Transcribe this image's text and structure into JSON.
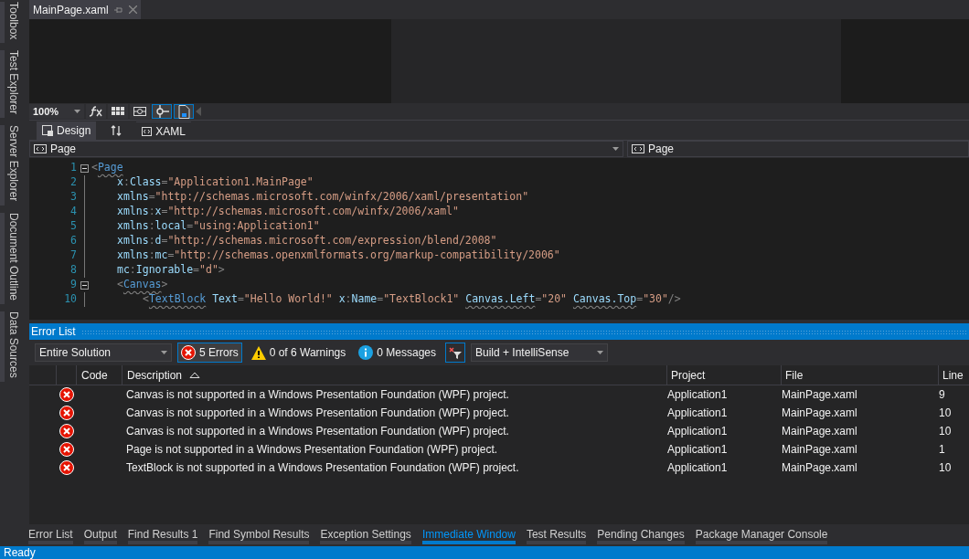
{
  "side_tabs": [
    "Toolbox",
    "Test Explorer",
    "Server Explorer",
    "Document Outline",
    "Data Sources"
  ],
  "document_tab": {
    "title": "MainPage.xaml"
  },
  "designer_toolbar": {
    "zoom": "100%",
    "buttons": [
      {
        "kind": "fx",
        "on": false
      },
      {
        "kind": "grid",
        "on": false
      },
      {
        "kind": "snap-grid",
        "on": false
      },
      {
        "kind": "snap-lines",
        "on": true
      },
      {
        "kind": "project-code",
        "on": true
      }
    ]
  },
  "view_tabs": [
    {
      "label": "Design",
      "kind": "design",
      "selected": true
    },
    {
      "label": "XAML",
      "kind": "xaml",
      "selected": false
    }
  ],
  "nav_bar": {
    "left": "Page",
    "right": "Page"
  },
  "code_lines": [
    {
      "number": "1",
      "fold": true,
      "tokens": [
        {
          "kind": "punct",
          "text": "<"
        },
        {
          "kind": "tag",
          "text": "Page",
          "squiggle": true
        }
      ]
    },
    {
      "number": "2",
      "fold": false,
      "tokens": [
        {
          "kind": "attr",
          "text": "x"
        },
        {
          "kind": "punct",
          "text": ":"
        },
        {
          "kind": "attr",
          "text": "Class"
        },
        {
          "kind": "punct",
          "text": "="
        },
        {
          "kind": "value",
          "text": "\"Application1.MainPage\""
        }
      ]
    },
    {
      "number": "3",
      "fold": false,
      "tokens": [
        {
          "kind": "attr",
          "text": "xmlns"
        },
        {
          "kind": "punct",
          "text": "="
        },
        {
          "kind": "value",
          "text": "\"http://schemas.microsoft.com/winfx/2006/xaml/presentation\""
        }
      ]
    },
    {
      "number": "4",
      "fold": false,
      "tokens": [
        {
          "kind": "attr",
          "text": "xmlns"
        },
        {
          "kind": "punct",
          "text": ":"
        },
        {
          "kind": "attr",
          "text": "x"
        },
        {
          "kind": "punct",
          "text": "="
        },
        {
          "kind": "value",
          "text": "\"http://schemas.microsoft.com/winfx/2006/xaml\""
        }
      ]
    },
    {
      "number": "5",
      "fold": false,
      "tokens": [
        {
          "kind": "attr",
          "text": "xmlns"
        },
        {
          "kind": "punct",
          "text": ":"
        },
        {
          "kind": "attr",
          "text": "local"
        },
        {
          "kind": "punct",
          "text": "="
        },
        {
          "kind": "value",
          "text": "\"using:Application1\""
        }
      ]
    },
    {
      "number": "6",
      "fold": false,
      "tokens": [
        {
          "kind": "attr",
          "text": "xmlns"
        },
        {
          "kind": "punct",
          "text": ":"
        },
        {
          "kind": "attr",
          "text": "d"
        },
        {
          "kind": "punct",
          "text": "="
        },
        {
          "kind": "value",
          "text": "\"http://schemas.microsoft.com/expression/blend/2008\""
        }
      ]
    },
    {
      "number": "7",
      "fold": false,
      "tokens": [
        {
          "kind": "attr",
          "text": "xmlns"
        },
        {
          "kind": "punct",
          "text": ":"
        },
        {
          "kind": "attr",
          "text": "mc"
        },
        {
          "kind": "punct",
          "text": "="
        },
        {
          "kind": "value",
          "text": "\"http://schemas.openxmlformats.org/markup-compatibility/2006\""
        }
      ]
    },
    {
      "number": "8",
      "fold": false,
      "tokens": [
        {
          "kind": "attr",
          "text": "mc"
        },
        {
          "kind": "punct",
          "text": ":"
        },
        {
          "kind": "attr",
          "text": "Ignorable"
        },
        {
          "kind": "punct",
          "text": "="
        },
        {
          "kind": "value",
          "text": "\"d\""
        },
        {
          "kind": "punct",
          "text": ">"
        }
      ]
    },
    {
      "number": "9",
      "fold": true,
      "tokens": [
        {
          "kind": "punct",
          "text": "<"
        },
        {
          "kind": "tag",
          "text": "Canvas",
          "squiggle": true
        },
        {
          "kind": "punct",
          "text": ">"
        }
      ]
    },
    {
      "number": "10",
      "fold": false,
      "indent": true,
      "tokens": [
        {
          "kind": "punct",
          "text": "<"
        },
        {
          "kind": "tag",
          "text": "TextBlock",
          "squiggle": true
        },
        {
          "kind": "attr",
          "text": " Text"
        },
        {
          "kind": "punct",
          "text": "="
        },
        {
          "kind": "value",
          "text": "\"Hello World!\""
        },
        {
          "kind": "attr",
          "text": " x"
        },
        {
          "kind": "punct",
          "text": ":"
        },
        {
          "kind": "attr",
          "text": "Name"
        },
        {
          "kind": "punct",
          "text": "="
        },
        {
          "kind": "value",
          "text": "\"TextBlock1\" "
        },
        {
          "kind": "attr",
          "text": "Canvas.Left",
          "squiggle": true
        },
        {
          "kind": "punct",
          "text": "="
        },
        {
          "kind": "value",
          "text": "\"20\" "
        },
        {
          "kind": "attr",
          "text": "Canvas.Top",
          "squiggle": true
        },
        {
          "kind": "punct",
          "text": "="
        },
        {
          "kind": "value",
          "text": "\"30\""
        },
        {
          "kind": "punct",
          "text": "/>"
        }
      ]
    }
  ],
  "error_list": {
    "title": "Error List",
    "scope": "Entire Solution",
    "filters": [
      {
        "kind": "error",
        "label": "5 Errors",
        "selected": true
      },
      {
        "kind": "warning",
        "label": "0 of 6 Warnings",
        "selected": false
      },
      {
        "kind": "info",
        "label": "0 Messages",
        "selected": false
      }
    ],
    "filter_toggle_on": true,
    "source": "Build + IntelliSense",
    "columns": [
      "Code",
      "Description",
      "Project",
      "File",
      "Line"
    ],
    "rows": [
      {
        "description": "Canvas is not supported in a Windows Presentation Foundation (WPF) project.",
        "project": "Application1",
        "file": "MainPage.xaml",
        "line": "9"
      },
      {
        "description": "Canvas is not supported in a Windows Presentation Foundation (WPF) project.",
        "project": "Application1",
        "file": "MainPage.xaml",
        "line": "10"
      },
      {
        "description": "Canvas is not supported in a Windows Presentation Foundation (WPF) project.",
        "project": "Application1",
        "file": "MainPage.xaml",
        "line": "10"
      },
      {
        "description": "Page is not supported in a Windows Presentation Foundation (WPF) project.",
        "project": "Application1",
        "file": "MainPage.xaml",
        "line": "1"
      },
      {
        "description": "TextBlock is not supported in a Windows Presentation Foundation (WPF) project.",
        "project": "Application1",
        "file": "MainPage.xaml",
        "line": "10"
      }
    ]
  },
  "bottom_tabs": [
    {
      "label": "Error List",
      "selected": false
    },
    {
      "label": "Output",
      "selected": false
    },
    {
      "label": "Find Results 1",
      "selected": false
    },
    {
      "label": "Find Symbol Results",
      "selected": false
    },
    {
      "label": "Exception Settings",
      "selected": false
    },
    {
      "label": "Immediate Window",
      "selected": true
    },
    {
      "label": "Test Results",
      "selected": false
    },
    {
      "label": "Pending Changes",
      "selected": false
    },
    {
      "label": "Package Manager Console",
      "selected": false
    }
  ],
  "status_bar": {
    "text": "Ready"
  }
}
